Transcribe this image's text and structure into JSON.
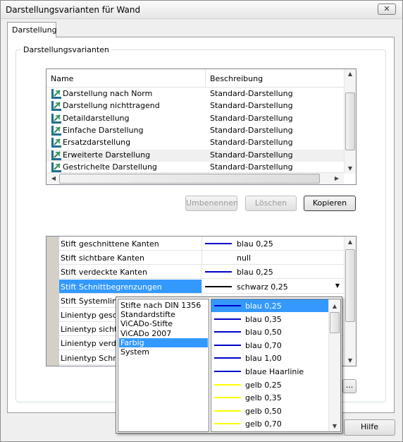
{
  "window": {
    "title": "Darstellungsvarianten für Wand",
    "close_glyph": "✕"
  },
  "tabs": [
    {
      "label": "Darstellung"
    }
  ],
  "group": {
    "label": "Darstellungsvarianten"
  },
  "variants": {
    "columns": [
      "Name",
      "Beschreibung"
    ],
    "rows": [
      {
        "name": "Darstellung nach Norm",
        "desc": "Standard-Darstellung"
      },
      {
        "name": "Darstellung nichttragend",
        "desc": "Standard-Darstellung"
      },
      {
        "name": "Detaildarstellung",
        "desc": "Standard-Darstellung"
      },
      {
        "name": "Einfache Darstellung",
        "desc": "Standard-Darstellung"
      },
      {
        "name": "Ersatzdarstellung",
        "desc": "Standard-Darstellung"
      },
      {
        "name": "Erweiterte Darstellung",
        "desc": "Standard-Darstellung"
      },
      {
        "name": "Gestrichelte Darstellung",
        "desc": "Standard-Darstellung"
      }
    ],
    "selected_index": 5
  },
  "buttons": {
    "rename": "Umbenennen",
    "delete": "Löschen",
    "copy": "Kopieren",
    "help": "Hilfe",
    "more": "..."
  },
  "properties": [
    {
      "key": "Stift geschnittene Kanten",
      "value": "blau 0,25",
      "line_color": "#0000cc"
    },
    {
      "key": "Stift sichtbare Kanten",
      "value": "null",
      "line_color": ""
    },
    {
      "key": "Stift verdeckte Kanten",
      "value": "blau 0,25",
      "line_color": "#0000cc"
    },
    {
      "key": "Stift Schnittbegrenzungen",
      "value": "schwarz 0,25",
      "line_color": "#000000"
    },
    {
      "key": "Stift Systemlinie",
      "value": "",
      "line_color": ""
    },
    {
      "key": "Linientyp gesch",
      "value": "",
      "line_color": ""
    },
    {
      "key": "Linientyp sichtb",
      "value": "",
      "line_color": ""
    },
    {
      "key": "Linientyp verde",
      "value": "",
      "line_color": ""
    },
    {
      "key": "Linientyp Schnit",
      "value": "",
      "line_color": ""
    }
  ],
  "properties_selected_index": 3,
  "pen_groups": {
    "items": [
      "Stifte nach DIN 1356",
      "Standardstifte",
      "ViCADo-Stifte",
      "ViCADo 2007",
      "Farbig",
      "System"
    ],
    "selected_index": 4
  },
  "pens": {
    "items": [
      {
        "label": "blau 0,25",
        "color": "#0000cc"
      },
      {
        "label": "blau 0,35",
        "color": "#0000cc"
      },
      {
        "label": "blau 0,50",
        "color": "#0000cc"
      },
      {
        "label": "blau 0,70",
        "color": "#0000cc"
      },
      {
        "label": "blau 1,00",
        "color": "#0000cc"
      },
      {
        "label": "blaue Haarlinie",
        "color": "#0000cc"
      },
      {
        "label": "gelb 0,25",
        "color": "#ffff00"
      },
      {
        "label": "gelb 0,35",
        "color": "#ffff00"
      },
      {
        "label": "gelb 0,50",
        "color": "#ffff00"
      },
      {
        "label": "gelb 0,70",
        "color": "#ffff00"
      }
    ],
    "selected_index": 0
  },
  "colors": {
    "selection": "#3399ff"
  }
}
